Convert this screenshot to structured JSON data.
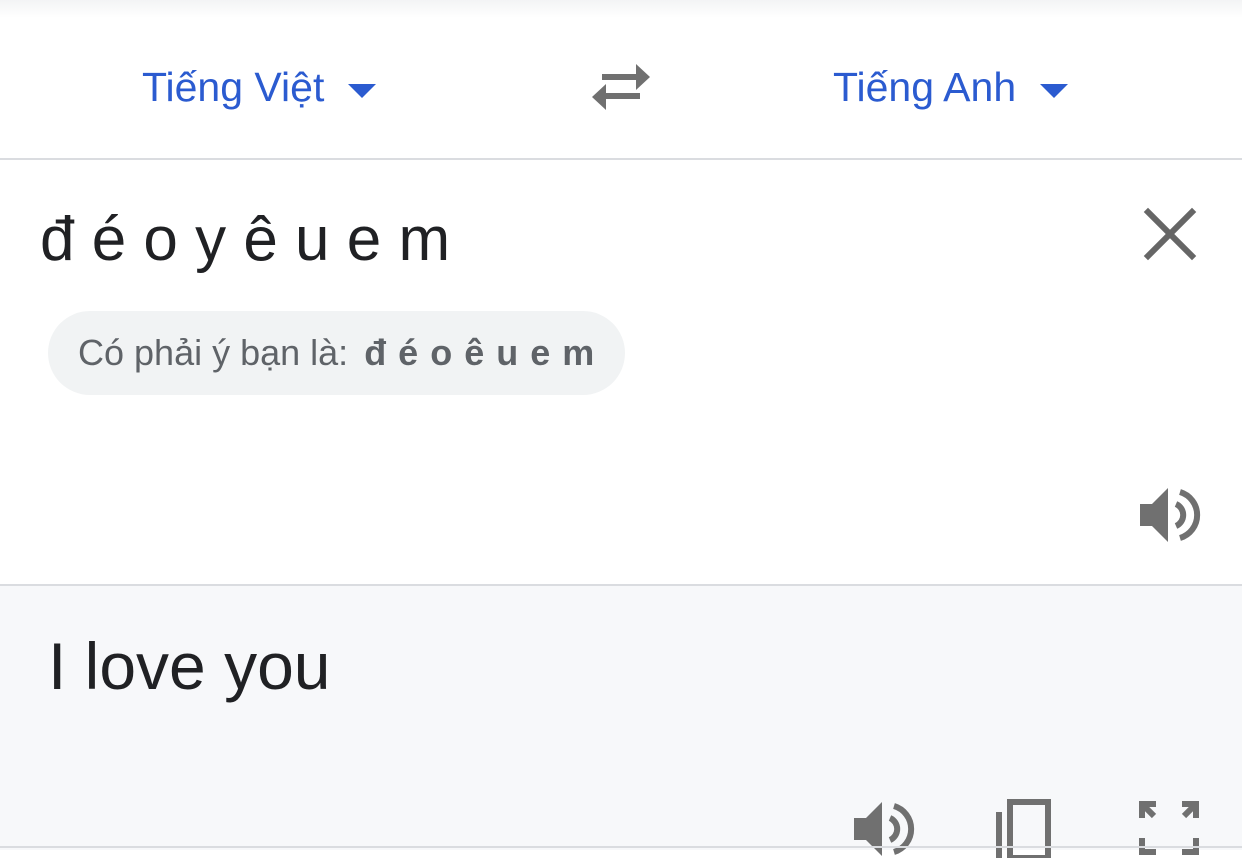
{
  "lang_bar": {
    "source_language": "Tiếng Việt",
    "target_language": "Tiếng Anh"
  },
  "source": {
    "text": "đ é o y ê u e m",
    "suggestion_prefix": "Có phải ý bạn là:",
    "suggestion_value": "đ é o ê u e m"
  },
  "target": {
    "text": "I love you"
  },
  "icons": {
    "swap": "swap-arrows-icon",
    "clear": "close-icon",
    "listen_source": "speaker-icon",
    "listen_target": "speaker-icon",
    "copy": "copy-icon",
    "fullscreen": "fullscreen-icon"
  },
  "colors": {
    "accent": "#2b5bd0",
    "icon": "#707070",
    "text": "#202124",
    "muted": "#5f6368",
    "target_bg": "#f7f8fa"
  }
}
